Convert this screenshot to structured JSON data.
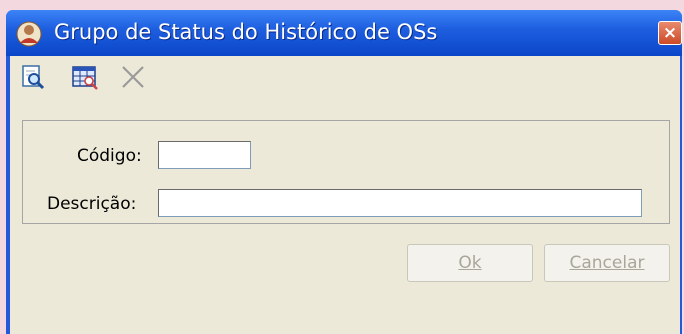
{
  "window": {
    "title": "Grupo de Status do Histórico de OSs",
    "close_glyph": "×"
  },
  "toolbar": {
    "icons": [
      "search-icon",
      "grid-search-icon",
      "delete-icon"
    ]
  },
  "form": {
    "codigo_label": "Código:",
    "codigo_value": "",
    "descricao_label": "Descrição:",
    "descricao_value": ""
  },
  "buttons": {
    "ok_label": "Ok",
    "cancel_label": "Cancelar"
  },
  "colors": {
    "titlebar": "#0a46c8",
    "client": "#ece9d8",
    "disabled_text": "#a9a69a"
  }
}
